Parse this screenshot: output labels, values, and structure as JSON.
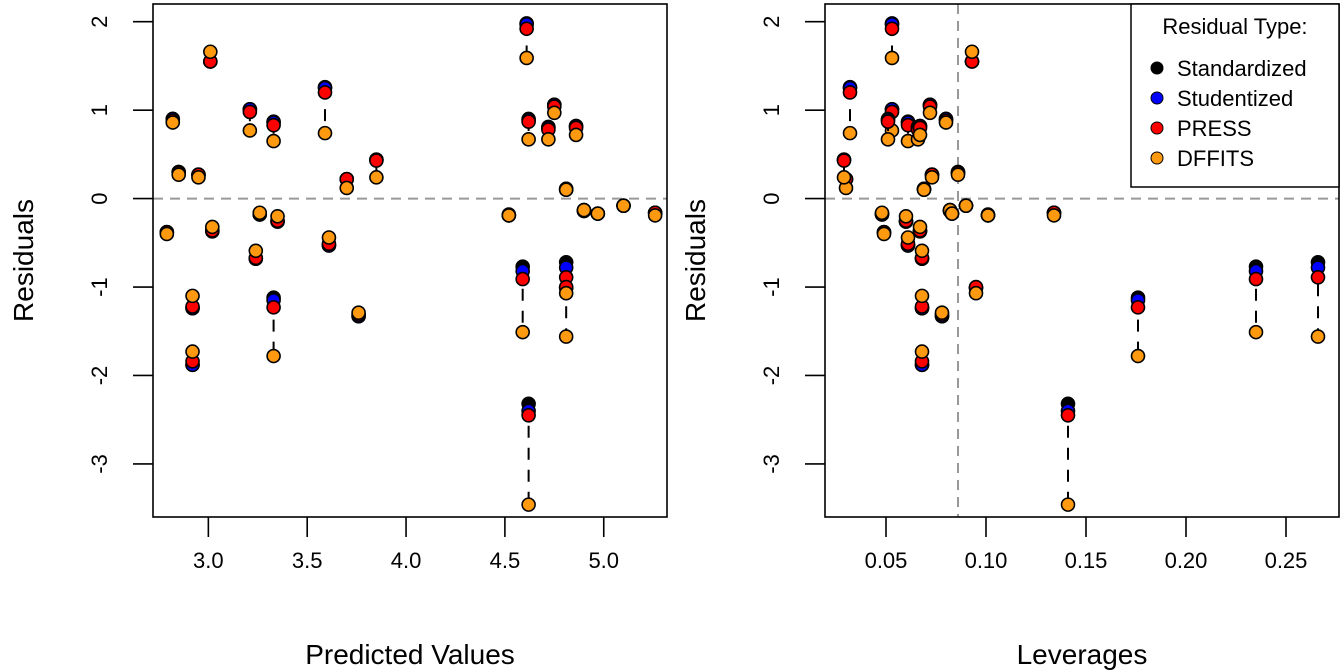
{
  "chart_data": [
    {
      "type": "scatter",
      "panel": "left",
      "title": "",
      "xlabel": "Predicted Values",
      "ylabel": "Residuals",
      "x_field": "predicted",
      "xlim": [
        2.72,
        5.32
      ],
      "ylim": [
        -3.6,
        2.2
      ],
      "xticks": [
        "3.0",
        "3.5",
        "4.0",
        "4.5",
        "5.0"
      ],
      "xtick_values": [
        3.0,
        3.5,
        4.0,
        4.5,
        5.0
      ],
      "yticks": [
        "-3",
        "-2",
        "-1",
        "0",
        "1",
        "2"
      ],
      "ytick_values": [
        -3,
        -2,
        -1,
        0,
        1,
        2
      ],
      "reference_lines": {
        "horizontal": 0
      },
      "legend": null
    },
    {
      "type": "scatter",
      "panel": "right",
      "title": "",
      "xlabel": "Leverages",
      "ylabel": "Residuals",
      "x_field": "leverage",
      "xlim": [
        0.0195,
        0.2765
      ],
      "ylim": [
        -3.6,
        2.2
      ],
      "xticks": [
        "0.05",
        "0.10",
        "0.15",
        "0.20",
        "0.25"
      ],
      "xtick_values": [
        0.05,
        0.1,
        0.15,
        0.2,
        0.25
      ],
      "yticks": [
        "-3",
        "-2",
        "-1",
        "0",
        "1",
        "2"
      ],
      "ytick_values": [
        -3,
        -2,
        -1,
        0,
        1,
        2
      ],
      "reference_lines": {
        "horizontal": 0,
        "vertical": 0.086
      },
      "legend": {
        "title": "Residual Type:",
        "placement": "top-right",
        "entries": [
          {
            "label": "Standardized",
            "color": "#000000"
          },
          {
            "label": "Studentized",
            "color": "#0000ff"
          },
          {
            "label": "PRESS",
            "color": "#ff0000"
          },
          {
            "label": "DFFITS",
            "color": "#ff9a10"
          }
        ]
      }
    }
  ],
  "series_order": [
    "standardized",
    "studentized",
    "press",
    "dffits"
  ],
  "series_colors": {
    "standardized": "#000000",
    "studentized": "#0000ff",
    "press": "#ff0000",
    "dffits": "#ff9a10"
  },
  "observations": [
    {
      "predicted": 4.61,
      "leverage": 0.053,
      "standardized": 1.98,
      "studentized": 1.97,
      "press": 1.92,
      "dffits": 1.59
    },
    {
      "predicted": 3.01,
      "leverage": 0.093,
      "standardized": 1.55,
      "studentized": 1.55,
      "press": 1.55,
      "dffits": 1.66
    },
    {
      "predicted": 3.59,
      "leverage": 0.032,
      "standardized": 1.26,
      "studentized": 1.25,
      "press": 1.2,
      "dffits": 0.74
    },
    {
      "predicted": 3.21,
      "leverage": 0.053,
      "standardized": 1.01,
      "studentized": 1.01,
      "press": 0.98,
      "dffits": 0.77
    },
    {
      "predicted": 3.33,
      "leverage": 0.061,
      "standardized": 0.87,
      "studentized": 0.86,
      "press": 0.83,
      "dffits": 0.65
    },
    {
      "predicted": 4.75,
      "leverage": 0.072,
      "standardized": 1.06,
      "studentized": 1.06,
      "press": 1.04,
      "dffits": 0.97
    },
    {
      "predicted": 4.62,
      "leverage": 0.051,
      "standardized": 0.9,
      "studentized": 0.89,
      "press": 0.87,
      "dffits": 0.67
    },
    {
      "predicted": 4.72,
      "leverage": 0.066,
      "standardized": 0.81,
      "studentized": 0.8,
      "press": 0.78,
      "dffits": 0.67
    },
    {
      "predicted": 4.86,
      "leverage": 0.067,
      "standardized": 0.82,
      "studentized": 0.82,
      "press": 0.8,
      "dffits": 0.72
    },
    {
      "predicted": 2.82,
      "leverage": 0.08,
      "standardized": 0.9,
      "studentized": 0.9,
      "press": 0.88,
      "dffits": 0.86
    },
    {
      "predicted": 2.85,
      "leverage": 0.086,
      "standardized": 0.3,
      "studentized": 0.3,
      "press": 0.29,
      "dffits": 0.27
    },
    {
      "predicted": 2.95,
      "leverage": 0.073,
      "standardized": 0.27,
      "studentized": 0.27,
      "press": 0.27,
      "dffits": 0.24
    },
    {
      "predicted": 3.7,
      "leverage": 0.03,
      "standardized": 0.22,
      "studentized": 0.22,
      "press": 0.22,
      "dffits": 0.12
    },
    {
      "predicted": 3.85,
      "leverage": 0.029,
      "standardized": 0.44,
      "studentized": 0.44,
      "press": 0.43,
      "dffits": 0.24
    },
    {
      "predicted": 4.81,
      "leverage": 0.069,
      "standardized": 0.11,
      "studentized": 0.11,
      "press": 0.1,
      "dffits": 0.1
    },
    {
      "predicted": 2.79,
      "leverage": 0.049,
      "standardized": -0.38,
      "studentized": -0.38,
      "press": -0.38,
      "dffits": -0.4
    },
    {
      "predicted": 3.02,
      "leverage": 0.067,
      "standardized": -0.37,
      "studentized": -0.37,
      "press": -0.36,
      "dffits": -0.32
    },
    {
      "predicted": 3.26,
      "leverage": 0.048,
      "standardized": -0.18,
      "studentized": -0.18,
      "press": -0.17,
      "dffits": -0.16
    },
    {
      "predicted": 3.35,
      "leverage": 0.06,
      "standardized": -0.26,
      "studentized": -0.26,
      "press": -0.25,
      "dffits": -0.2
    },
    {
      "predicted": 3.61,
      "leverage": 0.061,
      "standardized": -0.53,
      "studentized": -0.53,
      "press": -0.51,
      "dffits": -0.44
    },
    {
      "predicted": 3.24,
      "leverage": 0.068,
      "standardized": -0.68,
      "studentized": -0.68,
      "press": -0.67,
      "dffits": -0.59
    },
    {
      "predicted": 4.52,
      "leverage": 0.101,
      "standardized": -0.19,
      "studentized": -0.19,
      "press": -0.18,
      "dffits": -0.19
    },
    {
      "predicted": 4.9,
      "leverage": 0.082,
      "standardized": -0.14,
      "studentized": -0.14,
      "press": -0.13,
      "dffits": -0.13
    },
    {
      "predicted": 4.97,
      "leverage": 0.083,
      "standardized": -0.17,
      "studentized": -0.17,
      "press": -0.17,
      "dffits": -0.17
    },
    {
      "predicted": 5.1,
      "leverage": 0.09,
      "standardized": -0.08,
      "studentized": -0.08,
      "press": -0.08,
      "dffits": -0.08
    },
    {
      "predicted": 5.26,
      "leverage": 0.134,
      "standardized": -0.16,
      "studentized": -0.16,
      "press": -0.16,
      "dffits": -0.19
    },
    {
      "predicted": 3.76,
      "leverage": 0.078,
      "standardized": -1.33,
      "studentized": -1.33,
      "press": -1.31,
      "dffits": -1.29
    },
    {
      "predicted": 2.92,
      "leverage": 0.068,
      "standardized": -1.24,
      "studentized": -1.24,
      "press": -1.22,
      "dffits": -1.1
    },
    {
      "predicted": 2.92,
      "leverage": 0.068,
      "standardized": -1.88,
      "studentized": -1.88,
      "press": -1.84,
      "dffits": -1.73
    },
    {
      "predicted": 3.33,
      "leverage": 0.176,
      "standardized": -1.12,
      "studentized": -1.15,
      "press": -1.23,
      "dffits": -1.78
    },
    {
      "predicted": 4.59,
      "leverage": 0.235,
      "standardized": -0.77,
      "studentized": -0.82,
      "press": -0.91,
      "dffits": -1.51
    },
    {
      "predicted": 4.81,
      "leverage": 0.266,
      "standardized": -0.72,
      "studentized": -0.78,
      "press": -0.89,
      "dffits": -1.56
    },
    {
      "predicted": 4.81,
      "leverage": 0.095,
      "standardized": -1.01,
      "studentized": -1.01,
      "press": -1.0,
      "dffits": -1.07
    },
    {
      "predicted": 4.62,
      "leverage": 0.141,
      "standardized": -2.32,
      "studentized": -2.4,
      "press": -2.45,
      "dffits": -3.46
    }
  ]
}
